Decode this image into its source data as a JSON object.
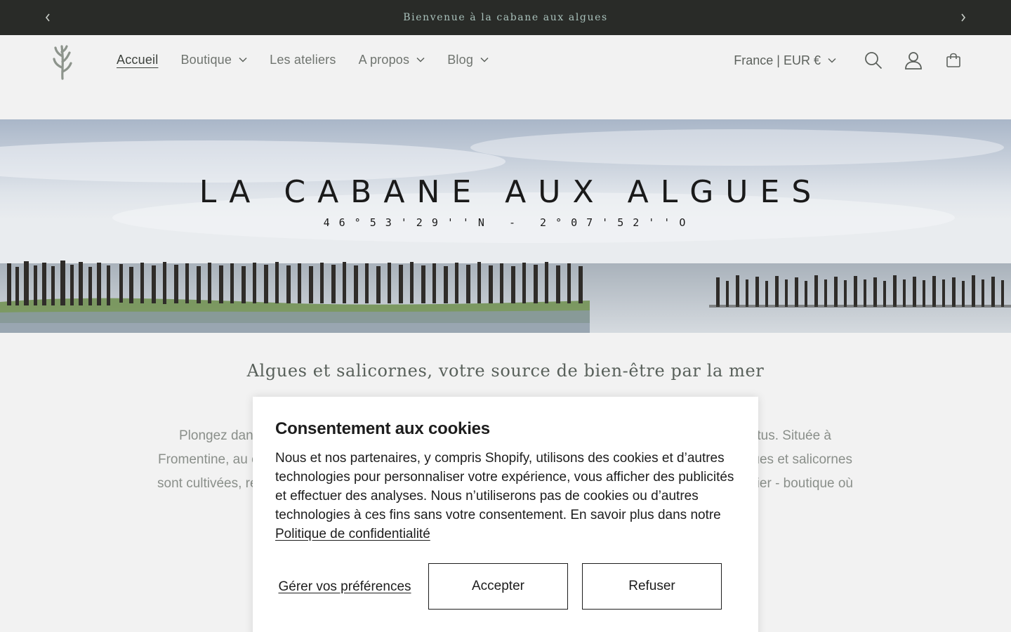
{
  "announcement": {
    "text": "Bienvenue à la cabane aux algues",
    "prev_icon": "chevron-left-icon",
    "next_icon": "chevron-right-icon"
  },
  "header": {
    "logo_icon": "seaweed-logo-icon",
    "nav": [
      {
        "label": "Accueil",
        "active": true,
        "has_dropdown": false
      },
      {
        "label": "Boutique",
        "active": false,
        "has_dropdown": true
      },
      {
        "label": "Les ateliers",
        "active": false,
        "has_dropdown": false
      },
      {
        "label": "A propos",
        "active": false,
        "has_dropdown": true
      },
      {
        "label": "Blog",
        "active": false,
        "has_dropdown": true
      }
    ],
    "locale": "France | EUR €",
    "icons": [
      "search-icon",
      "account-icon",
      "cart-icon"
    ]
  },
  "hero": {
    "title": "LA CABANE AUX ALGUES",
    "coords": "46°53'29''N - 2°07'52''O"
  },
  "intro": {
    "title": "Algues et salicornes, votre source de bien-être par la mer",
    "line1_left": "Plongez dans",
    "line1_right": "rtus. Située à",
    "line2_left": "Fromentine, au c",
    "line2_right": "gues et salicornes",
    "line3_left": "sont cultivées, ré",
    "line3_right": "lier - boutique où"
  },
  "cookie": {
    "title": "Consentement aux cookies",
    "body": "Nous et nos partenaires, y compris Shopify, utilisons des cookies et d’autres technologies pour personnaliser votre expérience, vous afficher des publicités et effectuer des analyses. Nous n’utiliserons pas de cookies ou d’autres technologies à ces fins sans votre consentement. En savoir plus dans notre ",
    "policy_link": "Politique de confidentialité",
    "manage_label": "Gérer vos préférences",
    "accept_label": "Accepter",
    "refuse_label": "Refuser"
  },
  "colors": {
    "announcement_bg": "#292b28",
    "announcement_text": "#a9c1bb",
    "page_bg": "#f2f2f2",
    "dialog_bg": "#ffffff"
  }
}
